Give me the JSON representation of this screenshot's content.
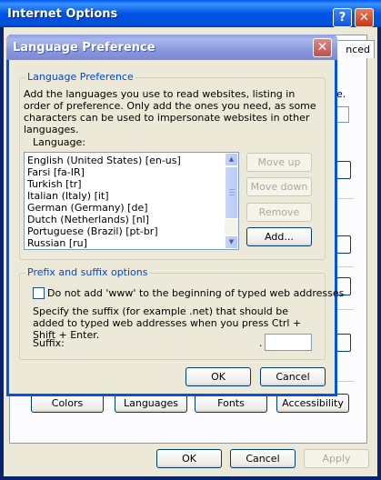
{
  "window": {
    "title": "Internet Options",
    "help_glyph": "?",
    "close_glyph": "✕",
    "tab_fragment": "nced",
    "right_fragment": "e.",
    "bottom_buttons": [
      "Colors",
      "Languages",
      "Fonts",
      "Accessibility"
    ],
    "ok": "OK",
    "cancel": "Cancel",
    "apply": "Apply"
  },
  "dialog": {
    "title": "Language Preference",
    "close_glyph": "✕",
    "language_group": {
      "label": "Language Preference",
      "description": "Add the languages you use to read websites, listing in order of preference. Only add the ones you need, as some characters can be used to impersonate websites in other languages.",
      "list_label": "Language:",
      "languages": [
        "English (United States) [en-us]",
        "Farsi [fa-IR]",
        "Turkish [tr]",
        "Italian (Italy) [it]",
        "German (Germany) [de]",
        "Dutch (Netherlands) [nl]",
        "Portuguese (Brazil) [pt-br]",
        "Russian [ru]"
      ],
      "move_up": "Move up",
      "move_down": "Move down",
      "remove": "Remove",
      "add": "Add..."
    },
    "suffix_group": {
      "label": "Prefix and suffix options",
      "checkbox_label": "Do not add 'www' to the beginning of typed web addresses",
      "checkbox_checked": false,
      "help_text": "Specify the suffix (for example .net) that should be added to typed web addresses when you press Ctrl + Shift + Enter.",
      "suffix_label": "Suffix:",
      "suffix_dot": ".",
      "suffix_value": ""
    },
    "ok": "OK",
    "cancel": "Cancel"
  }
}
